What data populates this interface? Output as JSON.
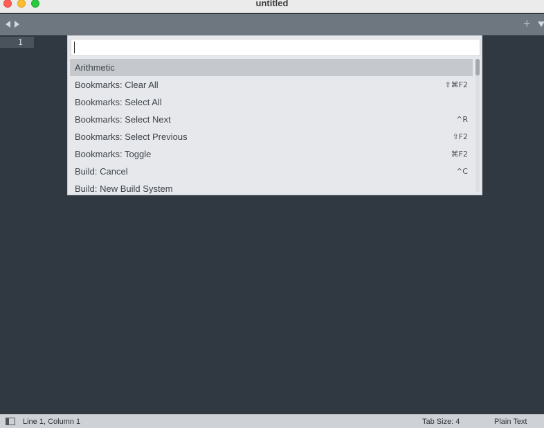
{
  "window": {
    "title": "untitled"
  },
  "tabbar": {
    "new_tab_label": "+"
  },
  "editor": {
    "line_numbers": [
      "1"
    ]
  },
  "palette": {
    "input_value": "",
    "items": [
      {
        "label": "Arithmetic",
        "shortcut": "",
        "selected": true
      },
      {
        "label": "Bookmarks: Clear All",
        "shortcut": "⇧⌘F2",
        "selected": false
      },
      {
        "label": "Bookmarks: Select All",
        "shortcut": "",
        "selected": false
      },
      {
        "label": "Bookmarks: Select Next",
        "shortcut": "^R",
        "selected": false
      },
      {
        "label": "Bookmarks: Select Previous",
        "shortcut": "⇧F2",
        "selected": false
      },
      {
        "label": "Bookmarks: Toggle",
        "shortcut": "⌘F2",
        "selected": false
      },
      {
        "label": "Build: Cancel",
        "shortcut": "^C",
        "selected": false
      },
      {
        "label": "Build: New Build System",
        "shortcut": "",
        "selected": false
      }
    ]
  },
  "statusbar": {
    "position": "Line 1, Column 1",
    "tab_size": "Tab Size: 4",
    "syntax": "Plain Text"
  },
  "icons": {
    "close": "close-icon",
    "minimize": "minimize-icon",
    "zoom": "zoom-icon",
    "nav_back": "chevron-left-icon",
    "nav_forward": "chevron-right-icon",
    "tab_menu": "chevron-down-icon",
    "panel": "sidebar-toggle-icon"
  }
}
